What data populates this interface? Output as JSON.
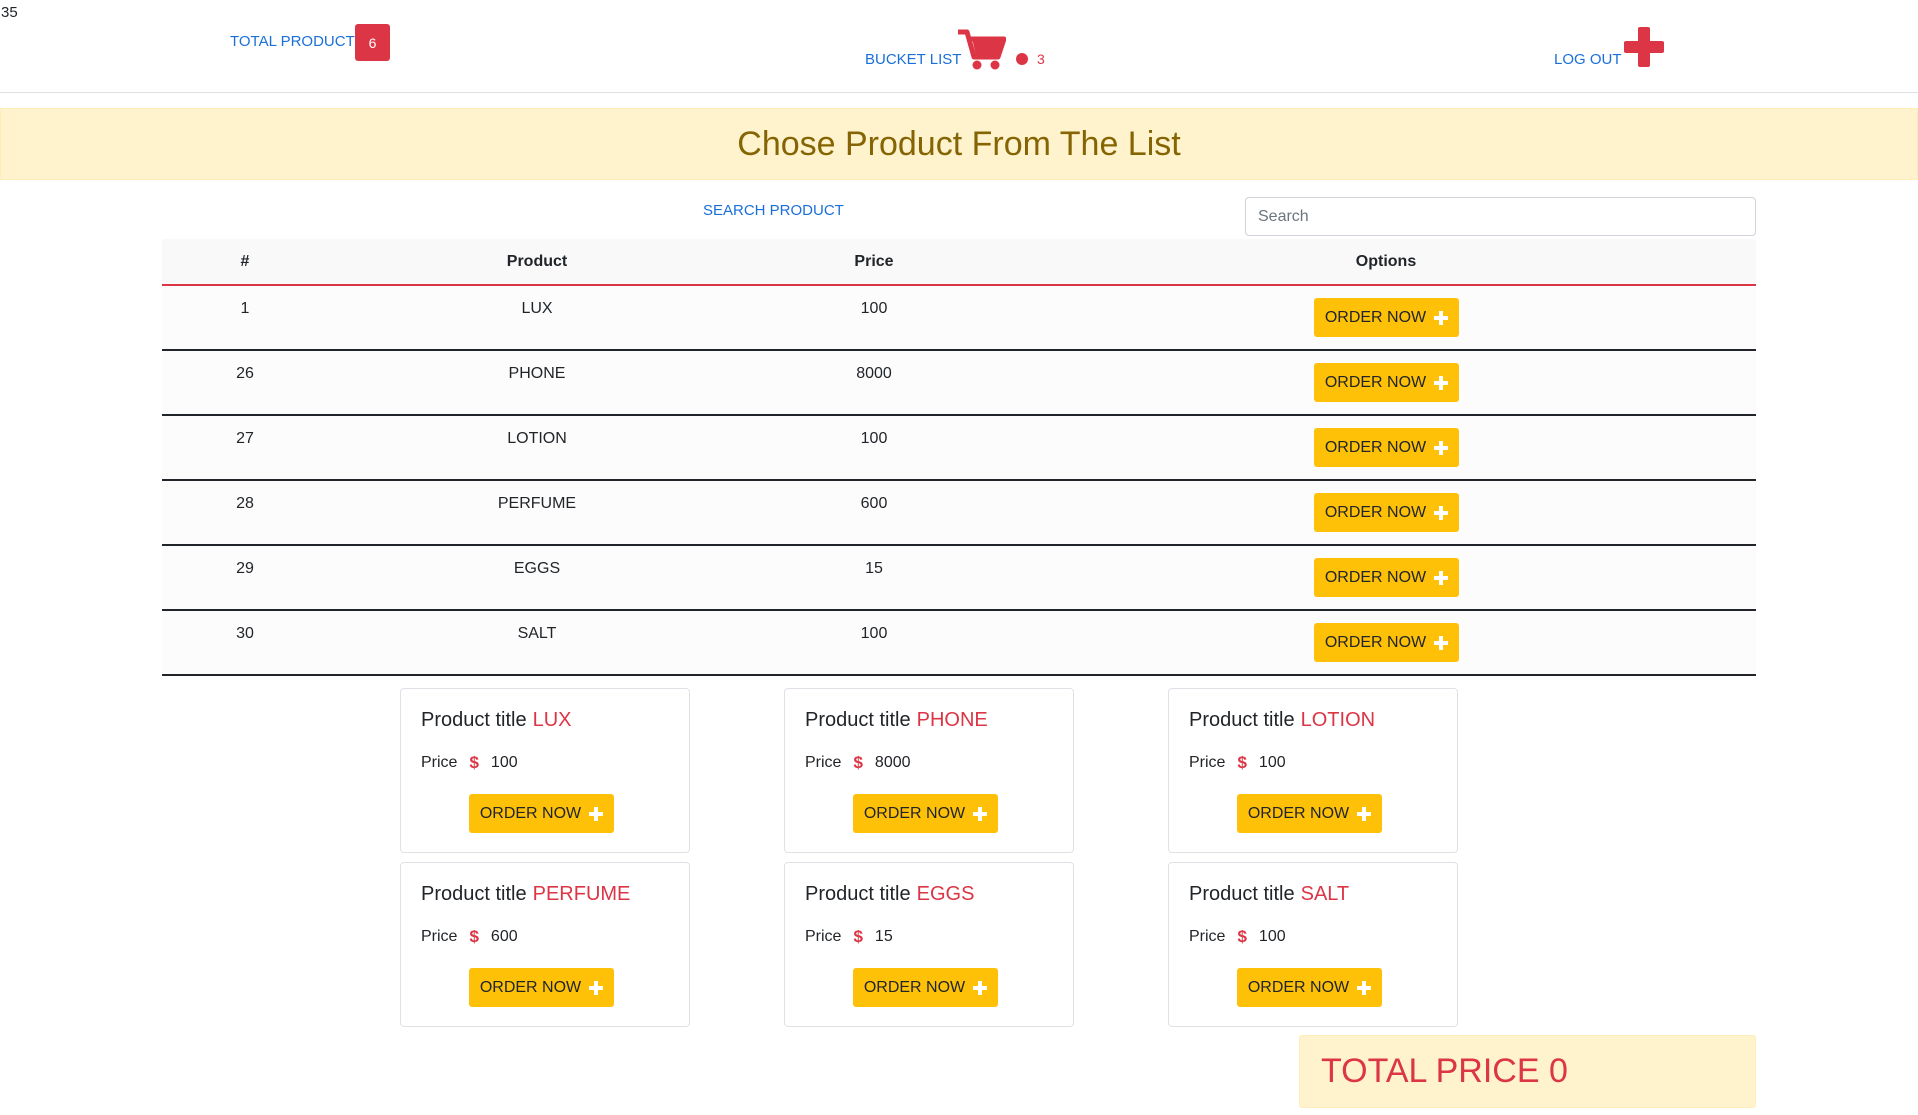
{
  "corner_text": "35",
  "header": {
    "total_product_label": "TOTAL PRODUCT",
    "total_product_count": "6",
    "bucket_label": "BUCKET LIST",
    "bucket_count": "3",
    "logout_label": "LOG OUT"
  },
  "banner_text": "Chose Product From The List",
  "search": {
    "label": "SEARCH PRODUCT",
    "placeholder": "Search",
    "value": ""
  },
  "table": {
    "headers": [
      "#",
      "Product",
      "Price",
      "Options"
    ],
    "rows": [
      {
        "id": "1",
        "product": "LUX",
        "price": "100",
        "button": "ORDER NOW"
      },
      {
        "id": "26",
        "product": "PHONE",
        "price": "8000",
        "button": "ORDER NOW"
      },
      {
        "id": "27",
        "product": "LOTION",
        "price": "100",
        "button": "ORDER NOW"
      },
      {
        "id": "28",
        "product": "PERFUME",
        "price": "600",
        "button": "ORDER NOW"
      },
      {
        "id": "29",
        "product": "EGGS",
        "price": "15",
        "button": "ORDER NOW"
      },
      {
        "id": "30",
        "product": "SALT",
        "price": "100",
        "button": "ORDER NOW"
      }
    ]
  },
  "cards": [
    {
      "title_prefix": "Product title",
      "name": "LUX",
      "price_label": "Price",
      "currency": "$",
      "price": "100",
      "button": "ORDER NOW"
    },
    {
      "title_prefix": "Product title",
      "name": "PHONE",
      "price_label": "Price",
      "currency": "$",
      "price": "8000",
      "button": "ORDER NOW"
    },
    {
      "title_prefix": "Product title",
      "name": "LOTION",
      "price_label": "Price",
      "currency": "$",
      "price": "100",
      "button": "ORDER NOW"
    },
    {
      "title_prefix": "Product title",
      "name": "PERFUME",
      "price_label": "Price",
      "currency": "$",
      "price": "600",
      "button": "ORDER NOW"
    },
    {
      "title_prefix": "Product title",
      "name": "EGGS",
      "price_label": "Price",
      "currency": "$",
      "price": "15",
      "button": "ORDER NOW"
    },
    {
      "title_prefix": "Product title",
      "name": "SALT",
      "price_label": "Price",
      "currency": "$",
      "price": "100",
      "button": "ORDER NOW"
    }
  ],
  "total_price_label": "TOTAL PRICE 0",
  "icons": {
    "cart": "shopping-cart-icon",
    "logout": "plus-icon",
    "order": "plus-icon",
    "bucket_dot": "dot-icon"
  },
  "colors": {
    "accent_red": "#dc3545",
    "link_blue": "#1a6fd8",
    "button_yellow": "#ffc107",
    "banner_bg": "#fff3cd",
    "banner_text": "#856404"
  }
}
